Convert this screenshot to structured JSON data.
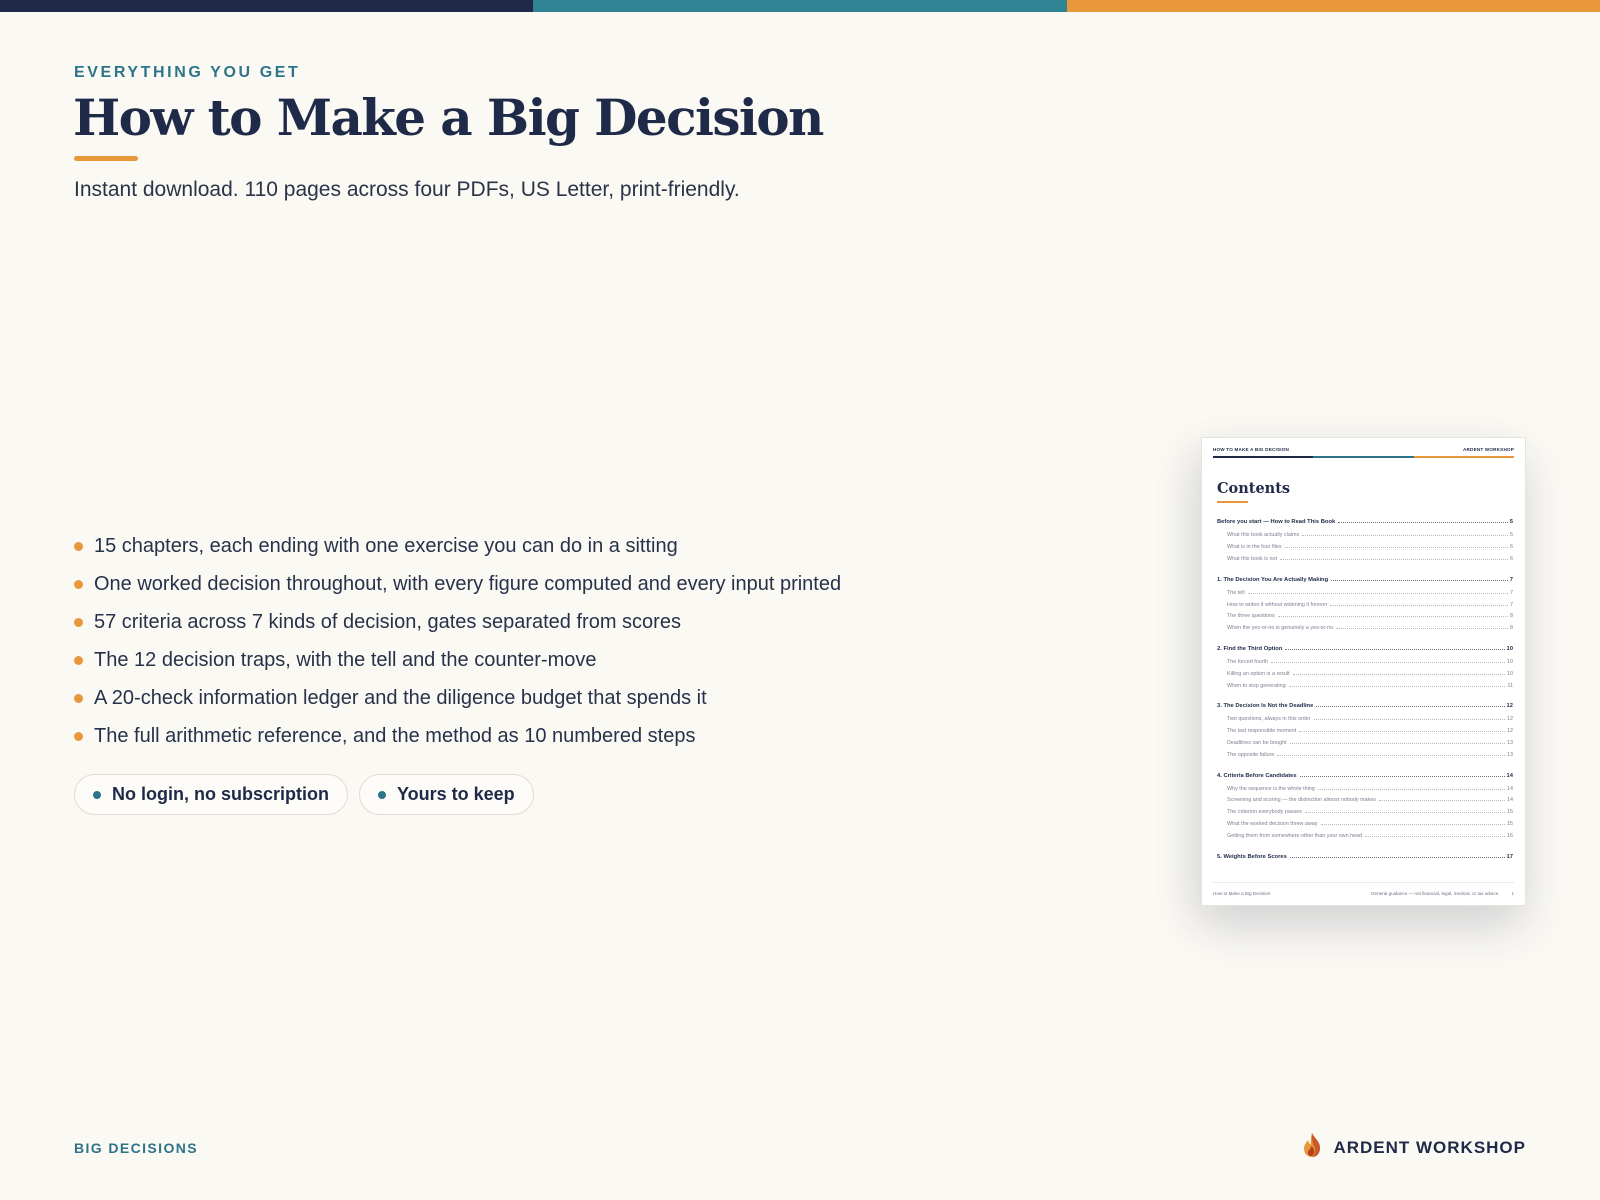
{
  "colors": {
    "navy": "#1e2a47",
    "teal": "#2e7488",
    "orange": "#e8973a",
    "background": "#fbf9f4"
  },
  "top_bar_colors": [
    "#1e2a47",
    "#2e8494",
    "#e8973a"
  ],
  "header": {
    "eyebrow": "EVERYTHING YOU GET",
    "title": "How to Make a Big Decision",
    "subtitle": "Instant download. 110 pages across four PDFs, US Letter, print-friendly."
  },
  "features": [
    "15 chapters, each ending with one exercise you can do in a sitting",
    "One worked decision throughout, with every figure computed and every input printed",
    "57 criteria across 7 kinds of decision, gates separated from scores",
    "The 12 decision traps, with the tell and the counter-move",
    "A 20-check information ledger and the diligence budget that spends it",
    "The full arithmetic reference, and the method as 10 numbered steps"
  ],
  "pills": [
    "No login, no subscription",
    "Yours to keep"
  ],
  "footer": {
    "left": "BIG DECISIONS",
    "brand": "ARDENT WORKSHOP",
    "brand_icon": "flame-icon"
  },
  "document_preview": {
    "header_left": "HOW TO MAKE A BIG DECISION",
    "header_right": "ARDENT WORKSHOP",
    "title": "Contents",
    "toc": [
      {
        "title": "Before you start — How to Read This Book",
        "page": "5",
        "items": [
          {
            "title": "What this book actually claims",
            "page": "5"
          },
          {
            "title": "What is in the four files",
            "page": "6"
          },
          {
            "title": "What this book is not",
            "page": "6"
          }
        ]
      },
      {
        "title": "1. The Decision You Are Actually Making",
        "page": "7",
        "items": [
          {
            "title": "The tell",
            "page": "7"
          },
          {
            "title": "How to widen it without widening it forever",
            "page": "7"
          },
          {
            "title": "The three questions",
            "page": "8"
          },
          {
            "title": "When the yes-or-no is genuinely a yes-or-no",
            "page": "8"
          }
        ]
      },
      {
        "title": "2. Find the Third Option",
        "page": "10",
        "items": [
          {
            "title": "The forced fourth",
            "page": "10"
          },
          {
            "title": "Killing an option is a result",
            "page": "10"
          },
          {
            "title": "When to stop generating",
            "page": "11"
          }
        ]
      },
      {
        "title": "3. The Decision Is Not the Deadline",
        "page": "12",
        "items": [
          {
            "title": "Two questions, always in this order",
            "page": "12"
          },
          {
            "title": "The last responsible moment",
            "page": "12"
          },
          {
            "title": "Deadlines can be bought",
            "page": "13"
          },
          {
            "title": "The opposite failure",
            "page": "13"
          }
        ]
      },
      {
        "title": "4. Criteria Before Candidates",
        "page": "14",
        "items": [
          {
            "title": "Why the sequence is the whole thing",
            "page": "14"
          },
          {
            "title": "Screening and scoring — the distinction almost nobody makes",
            "page": "14"
          },
          {
            "title": "The criterion everybody passes",
            "page": "15"
          },
          {
            "title": "What the worked decision threw away",
            "page": "15"
          },
          {
            "title": "Getting them from somewhere other than your own head",
            "page": "16"
          }
        ]
      },
      {
        "title": "5. Weights Before Scores",
        "page": "17",
        "items": []
      }
    ],
    "footer_left": "How to Make a Big Decision",
    "footer_right": "General guidance — not financial, legal, medical, or tax advice.",
    "page_number": "1"
  }
}
